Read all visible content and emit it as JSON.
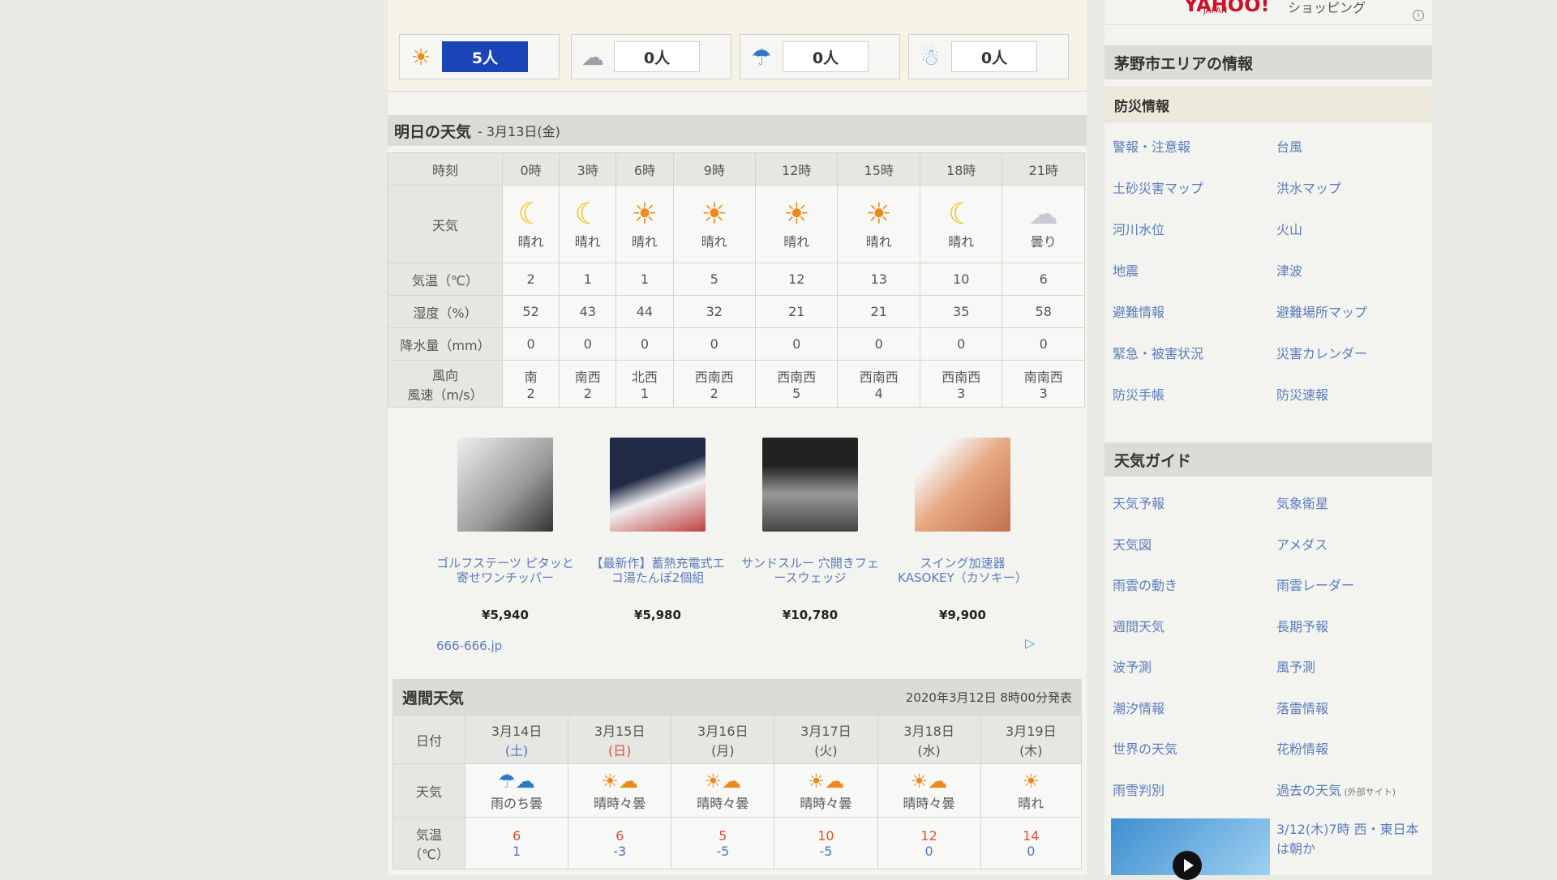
{
  "votes": [
    {
      "icon": "sun-icon",
      "glyph": "☀",
      "count": "5人",
      "active": true
    },
    {
      "icon": "cloud-icon",
      "glyph": "☁",
      "count": "0人",
      "active": false
    },
    {
      "icon": "umbrella-icon",
      "glyph": "☂",
      "count": "0人",
      "active": false
    },
    {
      "icon": "snowman-icon",
      "glyph": "☃",
      "count": "0人",
      "active": false
    }
  ],
  "tomorrow": {
    "title": "明日の天気",
    "date": "- 3月13日(金)",
    "labels": {
      "time": "時刻",
      "weather": "天気",
      "temp": "気温（℃）",
      "humidity": "湿度（%）",
      "precip": "降水量（mm）",
      "wind_dir": "風向",
      "wind_speed": "風速（m/s）"
    },
    "columns": [
      {
        "time": "0時",
        "icon": "moon-icon",
        "glyph": "☾",
        "cls": "moon",
        "weather": "晴れ",
        "temp": "2",
        "humidity": "52",
        "precip": "0",
        "dir": "南",
        "speed": "2"
      },
      {
        "time": "3時",
        "icon": "moon-icon",
        "glyph": "☾",
        "cls": "moon",
        "weather": "晴れ",
        "temp": "1",
        "humidity": "43",
        "precip": "0",
        "dir": "南西",
        "speed": "2"
      },
      {
        "time": "6時",
        "icon": "sun-icon",
        "glyph": "☀",
        "cls": "sun",
        "weather": "晴れ",
        "temp": "1",
        "humidity": "44",
        "precip": "0",
        "dir": "北西",
        "speed": "1"
      },
      {
        "time": "9時",
        "icon": "sun-icon",
        "glyph": "☀",
        "cls": "sun",
        "weather": "晴れ",
        "temp": "5",
        "humidity": "32",
        "precip": "0",
        "dir": "西南西",
        "speed": "2"
      },
      {
        "time": "12時",
        "icon": "sun-cloud-icon",
        "glyph": "☀",
        "cls": "sun",
        "weather": "晴れ",
        "temp": "12",
        "humidity": "21",
        "precip": "0",
        "dir": "西南西",
        "speed": "5"
      },
      {
        "time": "15時",
        "icon": "sun-icon",
        "glyph": "☀",
        "cls": "sun",
        "weather": "晴れ",
        "temp": "13",
        "humidity": "21",
        "precip": "0",
        "dir": "西南西",
        "speed": "4"
      },
      {
        "time": "18時",
        "icon": "moon-cloud-icon",
        "glyph": "☾",
        "cls": "moon",
        "weather": "晴れ",
        "temp": "10",
        "humidity": "35",
        "precip": "0",
        "dir": "西南西",
        "speed": "3"
      },
      {
        "time": "21時",
        "icon": "cloud-icon",
        "glyph": "☁",
        "cls": "cloud",
        "weather": "曇り",
        "temp": "6",
        "humidity": "58",
        "precip": "0",
        "dir": "南南西",
        "speed": "3"
      }
    ]
  },
  "ads": {
    "items": [
      {
        "name": "ゴルフステーツ ピタッと寄せワンチッパー",
        "price": "¥5,940",
        "color": "#d8d8d8"
      },
      {
        "name": "【最新作】蓄熱充電式エコ湯たんぽ2個組",
        "price": "¥5,980",
        "color": "#2a3550"
      },
      {
        "name": "サンドスルー 穴開きフェースウェッジ",
        "price": "¥10,780",
        "color": "#3a3a3a"
      },
      {
        "name": "スイング加速器KASOKEY（カソキー）",
        "price": "¥9,900",
        "color": "#e8b090"
      }
    ],
    "source": "666-666.jp"
  },
  "weekly": {
    "title": "週間天気",
    "issued": "2020年3月12日 8時00分発表",
    "labels": {
      "date": "日付",
      "weather": "天気",
      "temp": "気温",
      "temp_unit": "（℃）"
    },
    "days": [
      {
        "date": "3月14日",
        "dow": "(土)",
        "dowcls": "blue",
        "glyph": "☂☁",
        "weather": "雨のち曇",
        "high": "6",
        "low": "1"
      },
      {
        "date": "3月15日",
        "dow": "(日)",
        "dowcls": "red",
        "glyph": "☀☁",
        "weather": "晴時々曇",
        "high": "6",
        "low": "-3"
      },
      {
        "date": "3月16日",
        "dow": "(月)",
        "dowcls": "",
        "glyph": "☀☁",
        "weather": "晴時々曇",
        "high": "5",
        "low": "-5"
      },
      {
        "date": "3月17日",
        "dow": "(火)",
        "dowcls": "",
        "glyph": "☀☁",
        "weather": "晴時々曇",
        "high": "10",
        "low": "-5"
      },
      {
        "date": "3月18日",
        "dow": "(水)",
        "dowcls": "",
        "glyph": "☀☁",
        "weather": "晴時々曇",
        "high": "12",
        "low": "0"
      },
      {
        "date": "3月19日",
        "dow": "(木)",
        "dowcls": "",
        "glyph": "☀",
        "weather": "晴れ",
        "high": "14",
        "low": "0"
      }
    ]
  },
  "sidebar": {
    "brand": "YAHOO!",
    "brand_sub": "JAPAN",
    "brand_service": "ショッピング",
    "area_title": "茅野市エリアの情報",
    "disaster_title": "防災情報",
    "disaster_links": [
      "警報・注意報",
      "台風",
      "土砂災害マップ",
      "洪水マップ",
      "河川水位",
      "火山",
      "地震",
      "津波",
      "避難情報",
      "避難場所マップ",
      "緊急・被害状況",
      "災害カレンダー",
      "防災手帳",
      "防災速報"
    ],
    "guide_title": "天気ガイド",
    "guide_links": [
      "天気予報",
      "気象衛星",
      "天気図",
      "アメダス",
      "雨雲の動き",
      "雨雲レーダー",
      "週間天気",
      "長期予報",
      "波予測",
      "風予測",
      "潮汐情報",
      "落雷情報",
      "世界の天気",
      "花粉情報",
      "雨雪判別",
      "過去の天気"
    ],
    "external_note": "(外部サイト)",
    "news": "3/12(木)7時 西・東日本は朝か"
  }
}
